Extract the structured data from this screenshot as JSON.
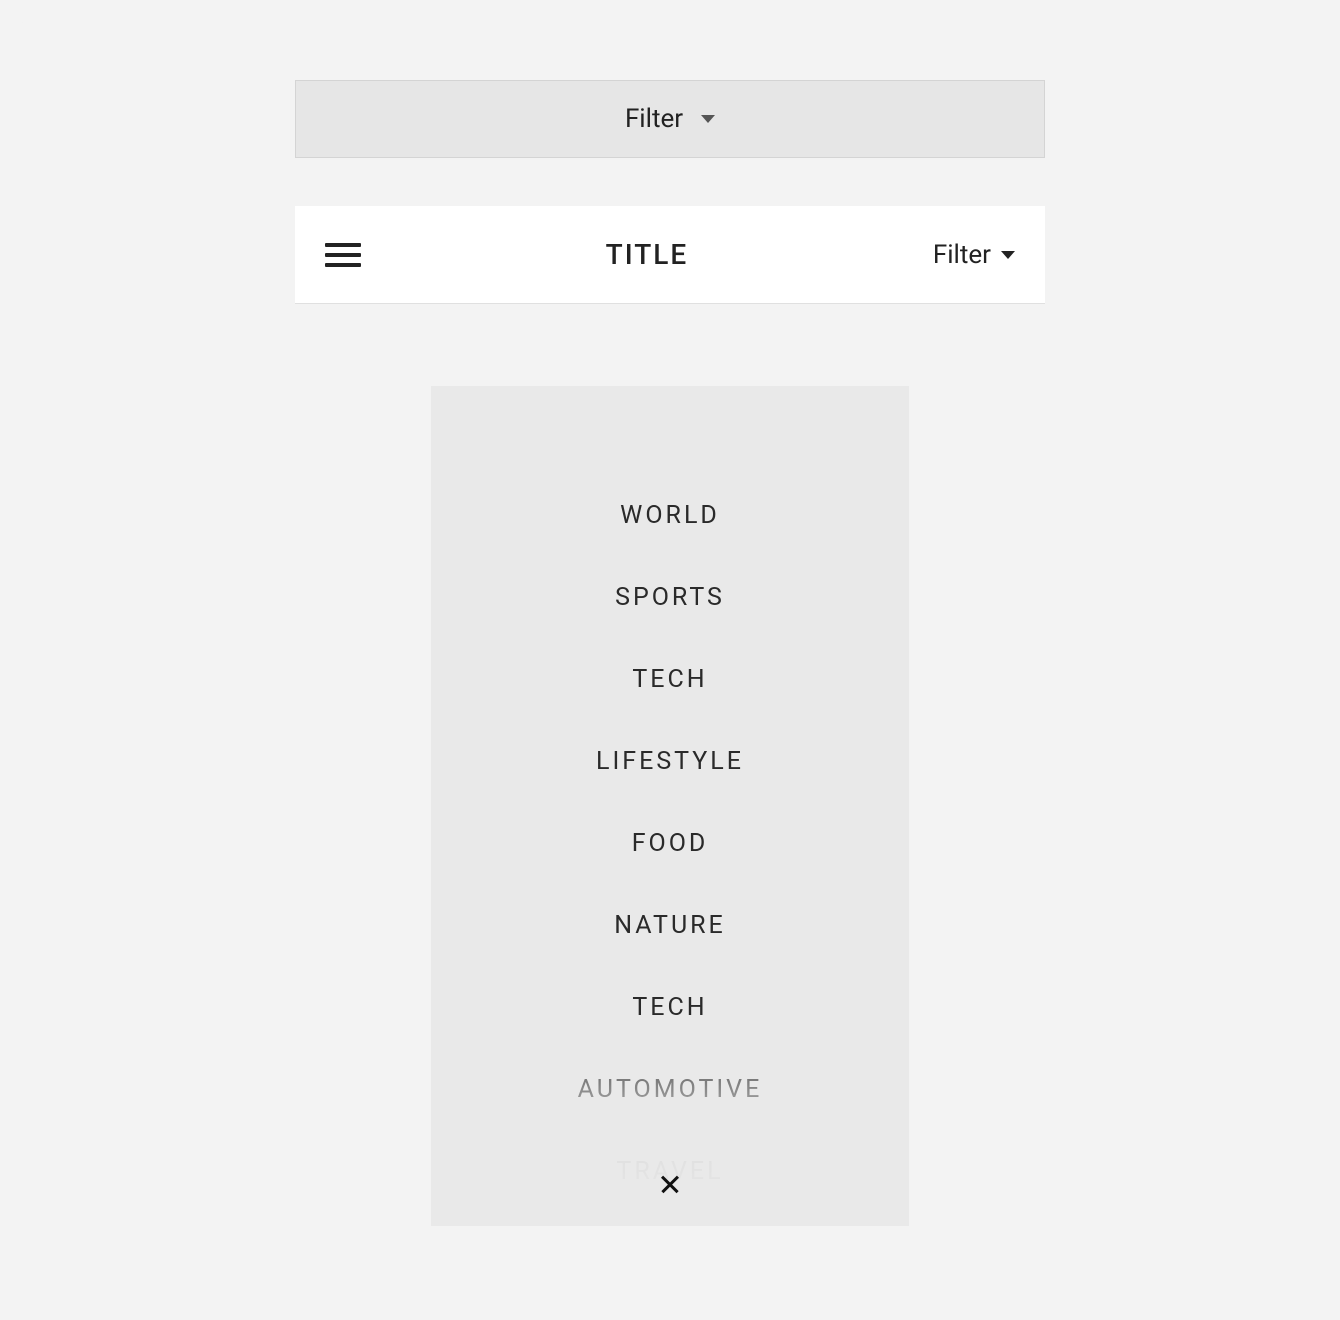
{
  "filter_bar": {
    "label": "Filter"
  },
  "header": {
    "title": "TITLE",
    "filter_label": "Filter"
  },
  "categories": [
    "WORLD",
    "SPORTS",
    "TECH",
    "LIFESTYLE",
    "FOOD",
    "NATURE",
    "TECH",
    "AUTOMOTIVE",
    "TRAVEL"
  ]
}
